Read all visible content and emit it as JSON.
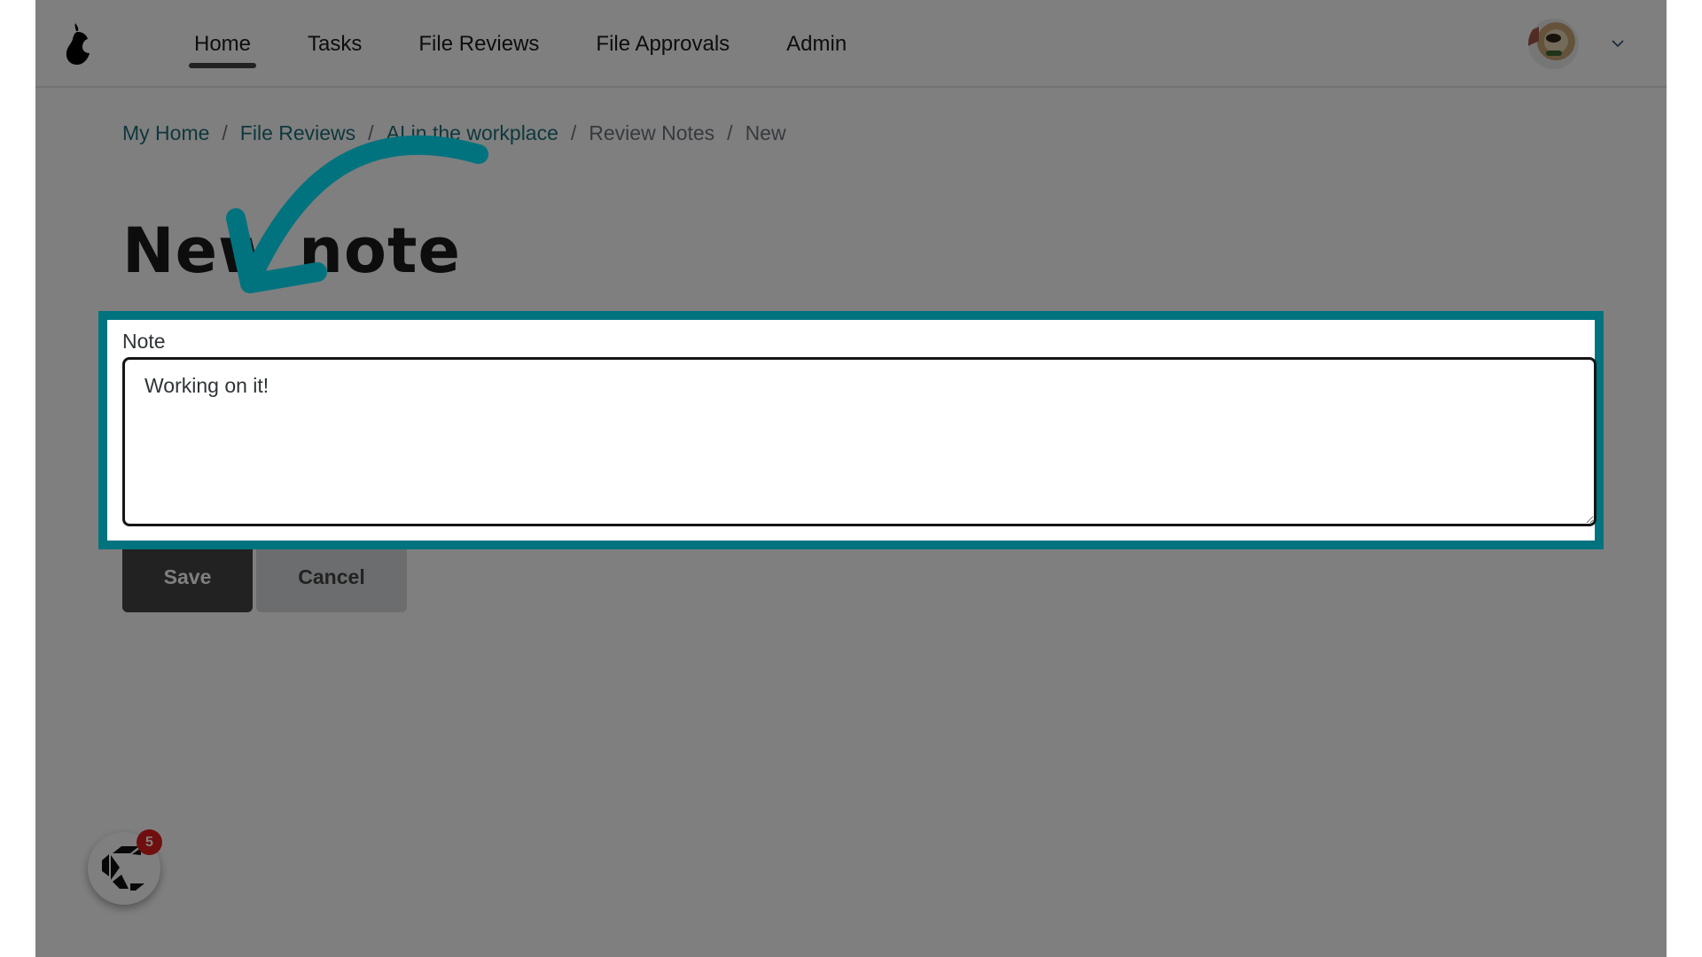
{
  "header": {
    "logo": "pear-logo-icon",
    "nav": [
      {
        "label": "Home",
        "active": true
      },
      {
        "label": "Tasks",
        "active": false
      },
      {
        "label": "File Reviews",
        "active": false
      },
      {
        "label": "File Approvals",
        "active": false
      },
      {
        "label": "Admin",
        "active": false
      }
    ],
    "avatar": "user-avatar-dog-photo",
    "menu_icon": "chevron-down-icon"
  },
  "breadcrumb": [
    {
      "label": "My Home",
      "link": true
    },
    {
      "label": "File Reviews",
      "link": true
    },
    {
      "label": "AI in the workplace",
      "link": true
    },
    {
      "label": "Review Notes",
      "link": false
    },
    {
      "label": "New",
      "link": false
    }
  ],
  "breadcrumb_separator": "/",
  "page": {
    "title": "New note"
  },
  "form": {
    "note_label": "Note",
    "note_value": "Working on it!",
    "save_label": "Save",
    "cancel_label": "Cancel"
  },
  "chat_widget": {
    "icon": "chat-logo-icon",
    "badge_count": "5"
  },
  "annotation": {
    "highlight_color": "#00737f",
    "arrow_color": "#00737f",
    "overlay_color": "#808080"
  }
}
